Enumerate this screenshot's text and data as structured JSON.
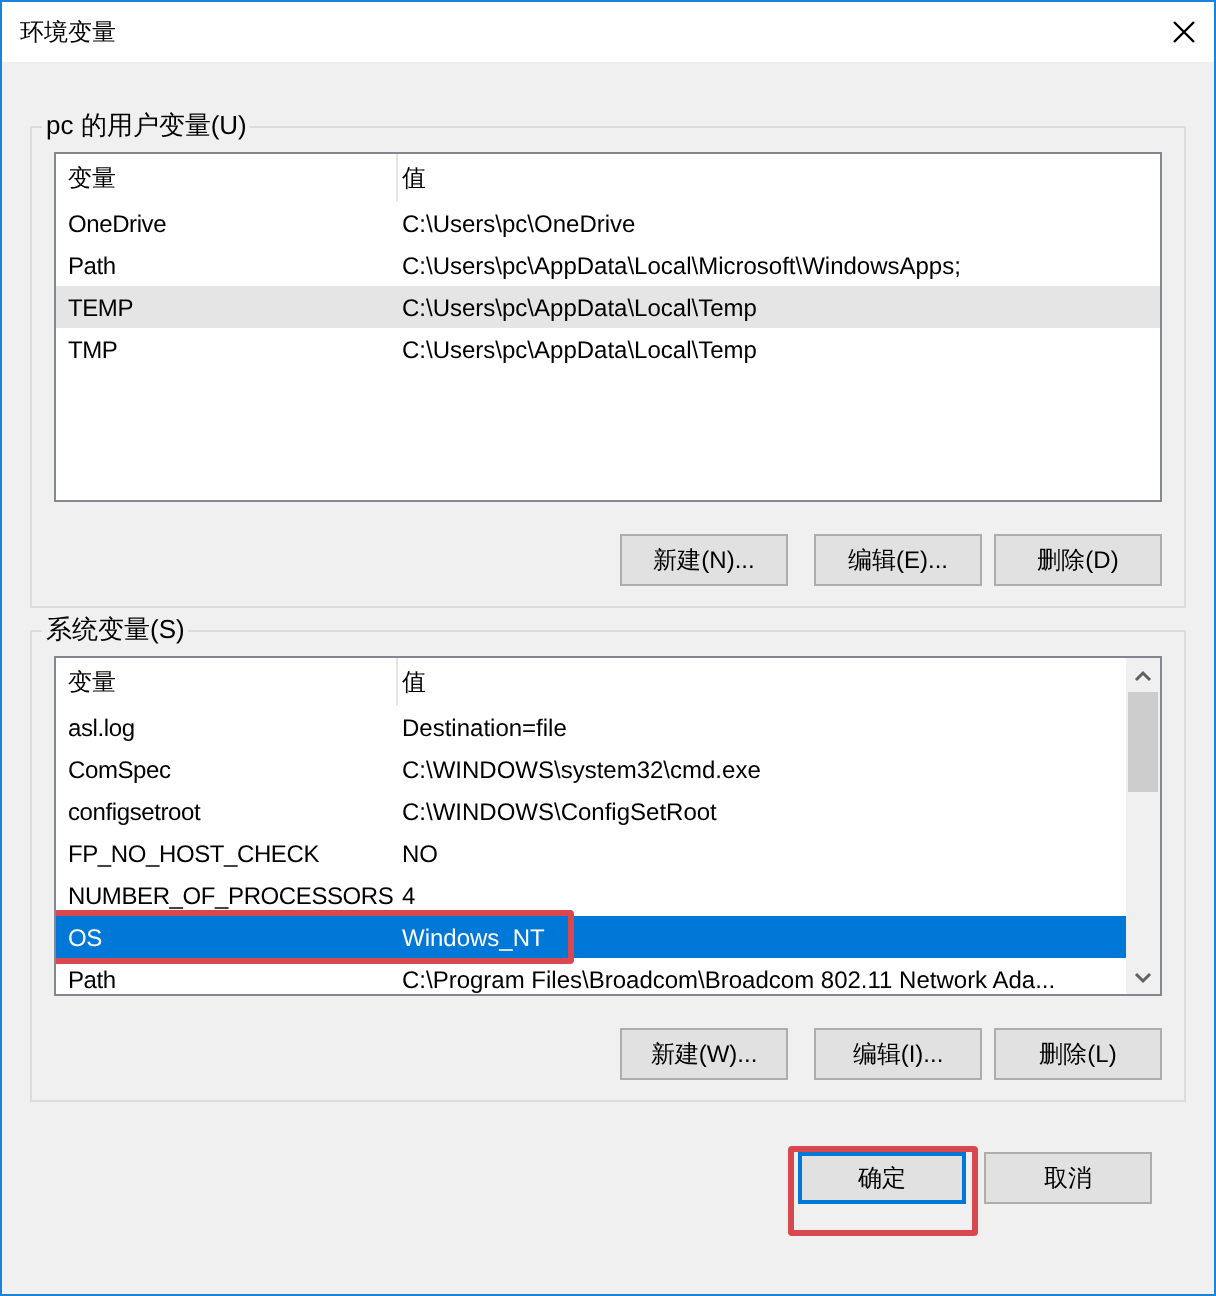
{
  "window": {
    "title": "环境变量"
  },
  "user_variables": {
    "label": "pc 的用户变量(U)",
    "focused": false,
    "scrollable": false,
    "columns": [
      "变量",
      "值"
    ],
    "rows": [
      {
        "name": "OneDrive",
        "value": "C:\\Users\\pc\\OneDrive",
        "selected": false,
        "highlighted": false
      },
      {
        "name": "Path",
        "value": "C:\\Users\\pc\\AppData\\Local\\Microsoft\\WindowsApps;",
        "selected": false,
        "highlighted": false
      },
      {
        "name": "TEMP",
        "value": "C:\\Users\\pc\\AppData\\Local\\Temp",
        "selected": true,
        "highlighted": false
      },
      {
        "name": "TMP",
        "value": "C:\\Users\\pc\\AppData\\Local\\Temp",
        "selected": false,
        "highlighted": false
      }
    ],
    "buttons": [
      "新建(N)...",
      "编辑(E)...",
      "删除(D)"
    ]
  },
  "system_variables": {
    "label": "系统变量(S)",
    "focused": true,
    "scrollable": true,
    "columns": [
      "变量",
      "值"
    ],
    "rows": [
      {
        "name": "asl.log",
        "value": "Destination=file",
        "selected": false,
        "highlighted": false
      },
      {
        "name": "ComSpec",
        "value": "C:\\WINDOWS\\system32\\cmd.exe",
        "selected": false,
        "highlighted": false
      },
      {
        "name": "configsetroot",
        "value": "C:\\WINDOWS\\ConfigSetRoot",
        "selected": false,
        "highlighted": false
      },
      {
        "name": "FP_NO_HOST_CHECK",
        "value": "NO",
        "selected": false,
        "highlighted": false
      },
      {
        "name": "NUMBER_OF_PROCESSORS",
        "value": "4",
        "selected": false,
        "highlighted": false
      },
      {
        "name": "OS",
        "value": "Windows_NT",
        "selected": true,
        "highlighted": true
      },
      {
        "name": "Path",
        "value": "C:\\Program Files\\Broadcom\\Broadcom 802.11 Network Ada...",
        "selected": false,
        "highlighted": false
      }
    ],
    "buttons": [
      "新建(W)...",
      "编辑(I)...",
      "删除(L)"
    ]
  },
  "dialog_buttons": [
    {
      "label": "确定",
      "default": true,
      "highlighted": true
    },
    {
      "label": "取消",
      "default": false,
      "highlighted": false
    }
  ]
}
